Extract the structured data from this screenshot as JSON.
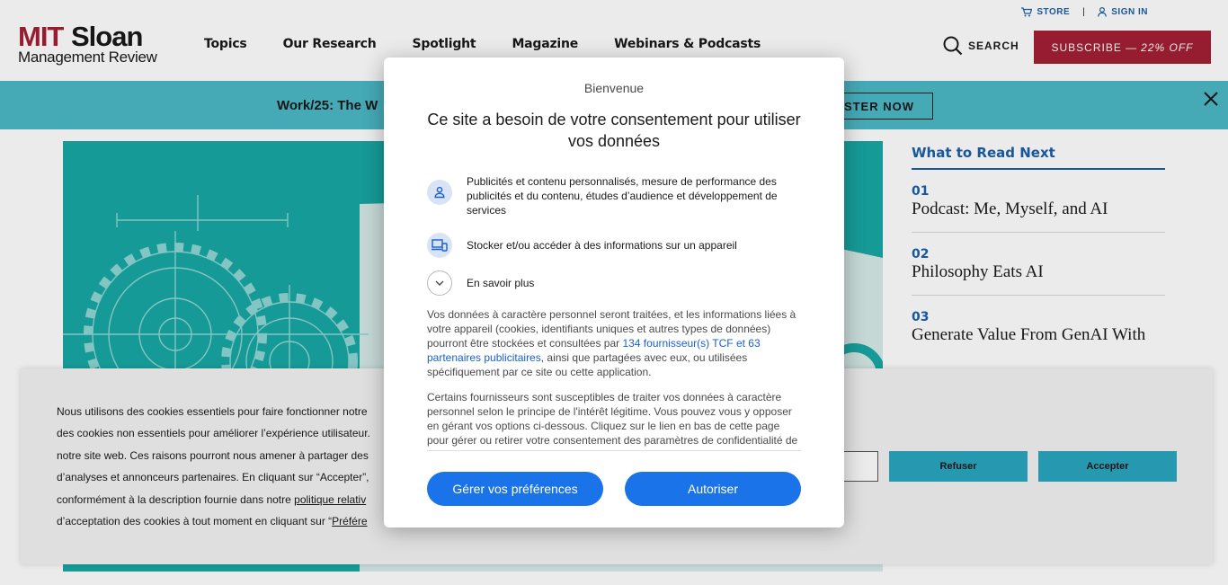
{
  "header": {
    "logo": {
      "mit": "MIT",
      "sloan": "Sloan",
      "subtitle": "Management Review"
    },
    "nav": [
      "Topics",
      "Our Research",
      "Spotlight",
      "Magazine",
      "Webinars & Podcasts"
    ],
    "utility": {
      "store": "STORE",
      "signin": "SIGN IN"
    },
    "search_label": "SEARCH",
    "subscribe": {
      "label": "SUBSCRIBE —",
      "discount": "22% OFF"
    }
  },
  "banner": {
    "text": "Work/25: The W",
    "register": "STER NOW"
  },
  "sidebar": {
    "title": "What to Read Next",
    "items": [
      {
        "num": "01",
        "title": "Podcast: Me, Myself, and AI"
      },
      {
        "num": "02",
        "title": "Philosophy Eats AI"
      },
      {
        "num": "03",
        "title": "Generate Value From GenAI With"
      }
    ]
  },
  "cookie": {
    "lines": [
      "Nous utilisons des cookies essentiels pour faire fonctionner notre",
      "des cookies non essentiels pour améliorer l’expérience utilisateur.",
      "notre site web. Ces raisons pourront nous amener à partager des",
      "d’analyses et annonceurs partenaires. En cliquant sur “Accepter”,",
      "conformément à la description fournie dans notre ",
      "d’acceptation des cookies à tout moment en cliquant sur “"
    ],
    "policy_link": "politique relativ",
    "prefs_link": "Préfére",
    "refuse": "Refuser",
    "accept": "Accepter"
  },
  "modal": {
    "welcome": "Bienvenue",
    "title": "Ce site a besoin de votre consentement pour utiliser vos données",
    "purposes": [
      "Publicités et contenu personnalisés, mesure de performance des publicités et du contenu, études d’audience et développement de services",
      "Stocker et/ou accéder à des informations sur un appareil",
      "En savoir plus"
    ],
    "para1_a": "Vos données à caractère personnel seront traitées, et les informations liées à votre appareil (cookies, identifiants uniques et autres types de données) pourront être stockées et consultées par ",
    "para1_link": "134 fournisseur(s) TCF et 63 partenaires publicitaires",
    "para1_b": ", ainsi que partagées avec eux, ou utilisées spécifiquement par ce site ou cette application.",
    "para2": "Certains fournisseurs sont susceptibles de traiter vos données à caractère personnel selon le principe de l'intérêt légitime. Vous pouvez vous y opposer en gérant vos options ci-dessous. Cliquez sur le lien en bas de cette page pour gérer ou retirer votre consentement des paramètres de confidentialité de ce site.",
    "manage_button": "Gérer vos préférences",
    "allow_button": "Autoriser"
  },
  "colors": {
    "brand_red": "#a31f34",
    "banner_teal": "#4bb8c6",
    "link_blue": "#1a5fa8",
    "consent_blue": "#1a73e8"
  }
}
